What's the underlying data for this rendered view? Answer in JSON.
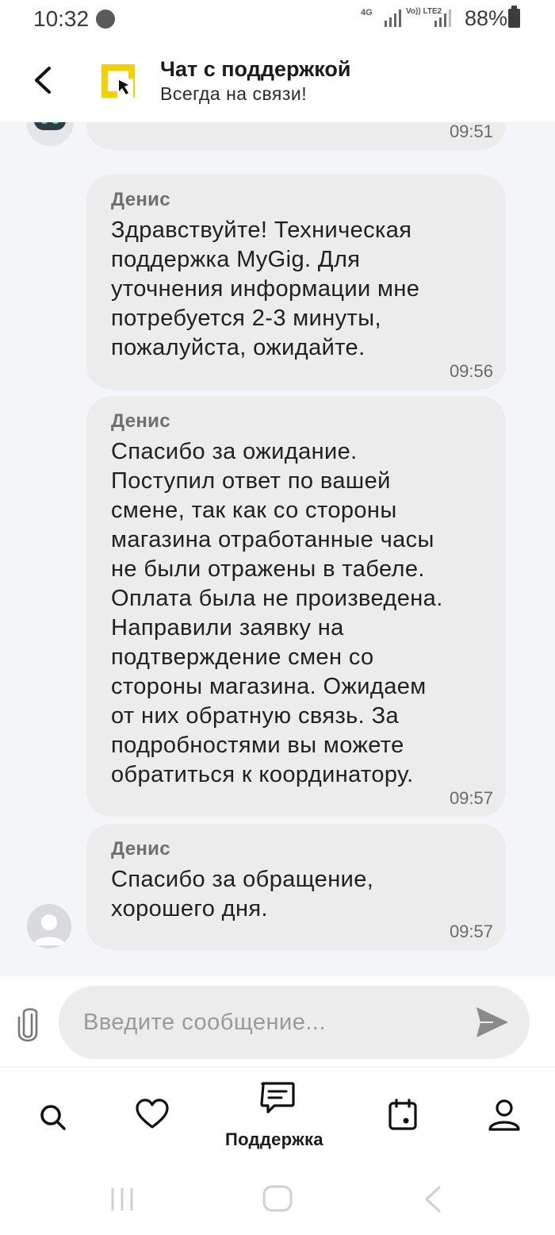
{
  "status_bar": {
    "time": "10:32",
    "network": "4G",
    "volte": "Vo)) LTE2",
    "battery": "88%"
  },
  "header": {
    "title": "Чат с поддержкой",
    "subtitle": "Всегда на связи!",
    "back_icon": "chevron-left-icon",
    "brand_color": "#f5d000"
  },
  "chat": {
    "partial_message_time": "09:51",
    "messages": [
      {
        "sender": "Денис",
        "text": "Здравствуйте! Техническая\nподдержка MyGig. Для\nуточнения информации мне\nпотребуется 2-3 минуты,\nпожалуйста, ожидайте.",
        "time": "09:56"
      },
      {
        "sender": "Денис",
        "text": "Спасибо за ожидание.\nПоступил ответ по вашей\nсмене, так как со стороны\nмагазина отработанные часы\nне были отражены в табеле.\nОплата была не произведена.\nНаправили заявку на\nподтверждение смен со\nстороны магазина. Ожидаем\nот них обратную связь. За\nподробностями вы можете\nобратиться к координатору.",
        "time": "09:57"
      },
      {
        "sender": "Денис",
        "text": "Спасибо за обращение,\nхорошего дня.",
        "time": "09:57"
      }
    ]
  },
  "composer": {
    "placeholder": "Введите сообщение...",
    "value": ""
  },
  "bottom_nav": {
    "active_label": "Поддержка",
    "items": [
      "search-icon",
      "heart-icon",
      "chat-support-icon",
      "calendar-icon",
      "profile-icon"
    ]
  },
  "colors": {
    "bubble": "#ececec",
    "chat_background": "#f4f5f8",
    "text": "#202020",
    "muted": "#6a6a6a"
  }
}
